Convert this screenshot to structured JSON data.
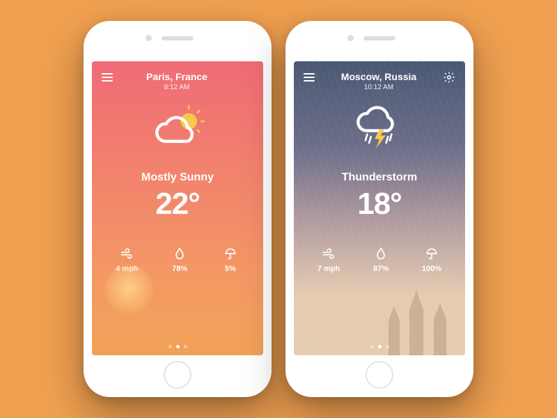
{
  "phones": [
    {
      "id": "paris",
      "city": "Paris, France",
      "time": "8:12 AM",
      "condition": "Mostly Sunny",
      "temperature": "22°",
      "icon": "partly-sunny",
      "right_action": "none",
      "stats": {
        "wind": "4 mph",
        "humidity": "78%",
        "precip": "5%"
      },
      "pager": {
        "count": 3,
        "active": 1
      }
    },
    {
      "id": "moscow",
      "city": "Moscow, Russia",
      "time": "10:12 AM",
      "condition": "Thunderstorm",
      "temperature": "18°",
      "icon": "thunderstorm",
      "right_action": "settings",
      "stats": {
        "wind": "7 mph",
        "humidity": "87%",
        "precip": "100%"
      },
      "pager": {
        "count": 3,
        "active": 1
      }
    }
  ]
}
